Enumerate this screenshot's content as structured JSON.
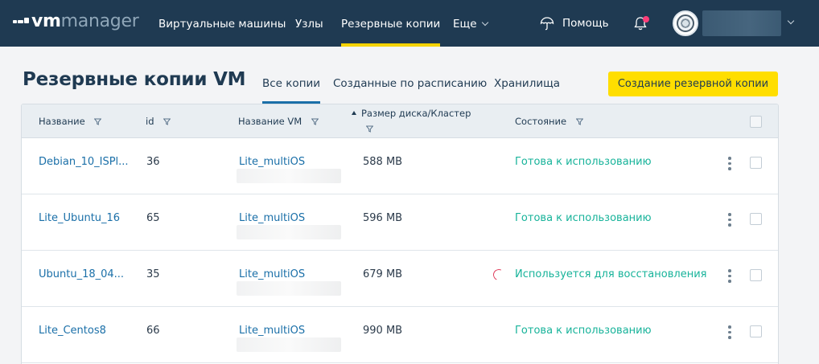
{
  "header": {
    "logo": {
      "vm": "vm",
      "manager": "manager"
    },
    "nav": [
      {
        "label": "Виртуальные машины"
      },
      {
        "label": "Узлы"
      },
      {
        "label": "Резервные копии"
      },
      {
        "label": "Еще"
      }
    ],
    "help_label": "Помощь",
    "accent_color": "#f5d300",
    "background_color": "#1f3a52",
    "notification_dot_color": "#ff3d79"
  },
  "page": {
    "title": "Резервные копии VM",
    "tabs": [
      {
        "label": "Все копии",
        "active": true
      },
      {
        "label": "Созданные по расписанию",
        "active": false
      },
      {
        "label": "Хранилища",
        "active": false
      }
    ],
    "create_button_label": "Создание резервной копии"
  },
  "table": {
    "columns": [
      {
        "label": "Название"
      },
      {
        "label": "id"
      },
      {
        "label": "Название VM"
      },
      {
        "label": "Размер диска/Кластер"
      },
      {
        "label": "Состояние"
      }
    ],
    "rows": [
      {
        "name": "Debian_10_ISPl...",
        "id": "36",
        "vm": "Lite_multiOS",
        "size": "588 MB",
        "status": "Готова к использованию",
        "restoring": false
      },
      {
        "name": "Lite_Ubuntu_16",
        "id": "65",
        "vm": "Lite_multiOS",
        "size": "596 MB",
        "status": "Готова к использованию",
        "restoring": false
      },
      {
        "name": "Ubuntu_18_04...",
        "id": "35",
        "vm": "Lite_multiOS",
        "size": "679 MB",
        "status": "Используется для восстановления",
        "restoring": true
      },
      {
        "name": "Lite_Centos8",
        "id": "66",
        "vm": "Lite_multiOS",
        "size": "990 MB",
        "status": "Готова к использованию",
        "restoring": false
      }
    ],
    "status_color": "#17b39a",
    "link_color": "#1a6fa8"
  }
}
